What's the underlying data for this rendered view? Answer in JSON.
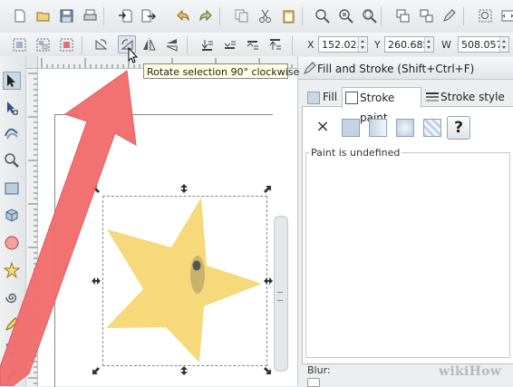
{
  "toolbar_top": {
    "icons": [
      "new-document-icon",
      "open-icon",
      "save-icon",
      "print-icon",
      "import-icon",
      "export-icon",
      "undo-icon",
      "redo-icon",
      "duplicate-icon",
      "cut-icon",
      "paste-icon",
      "zoom-selection-icon",
      "zoom-drawing-icon",
      "zoom-page-icon",
      "group-icon",
      "ungroup-icon",
      "fill-stroke-icon",
      "zoom-fit-icon",
      "xml-editor-icon"
    ]
  },
  "toolbar_select": {
    "x_label": "X",
    "x_value": "152.023",
    "y_label": "Y",
    "y_value": "260.685",
    "w_label": "W",
    "w_value": "508.057"
  },
  "tooltip": "Rotate selection 90° clockwise",
  "panel": {
    "title": "Fill and Stroke (Shift+Ctrl+F)",
    "tabs": [
      "Fill",
      "Stroke paint",
      "Stroke style"
    ],
    "paint_status": "Paint is undefined",
    "blur_label": "Blur:"
  },
  "paint_buttons": {
    "none_symbol": "×",
    "unset_symbol": "?"
  },
  "watermark": "wikiHow",
  "colors": {
    "star_fill": "#f5d97b",
    "arrow": "#f26d6d",
    "tooltip_bg": "#ffffe1"
  }
}
